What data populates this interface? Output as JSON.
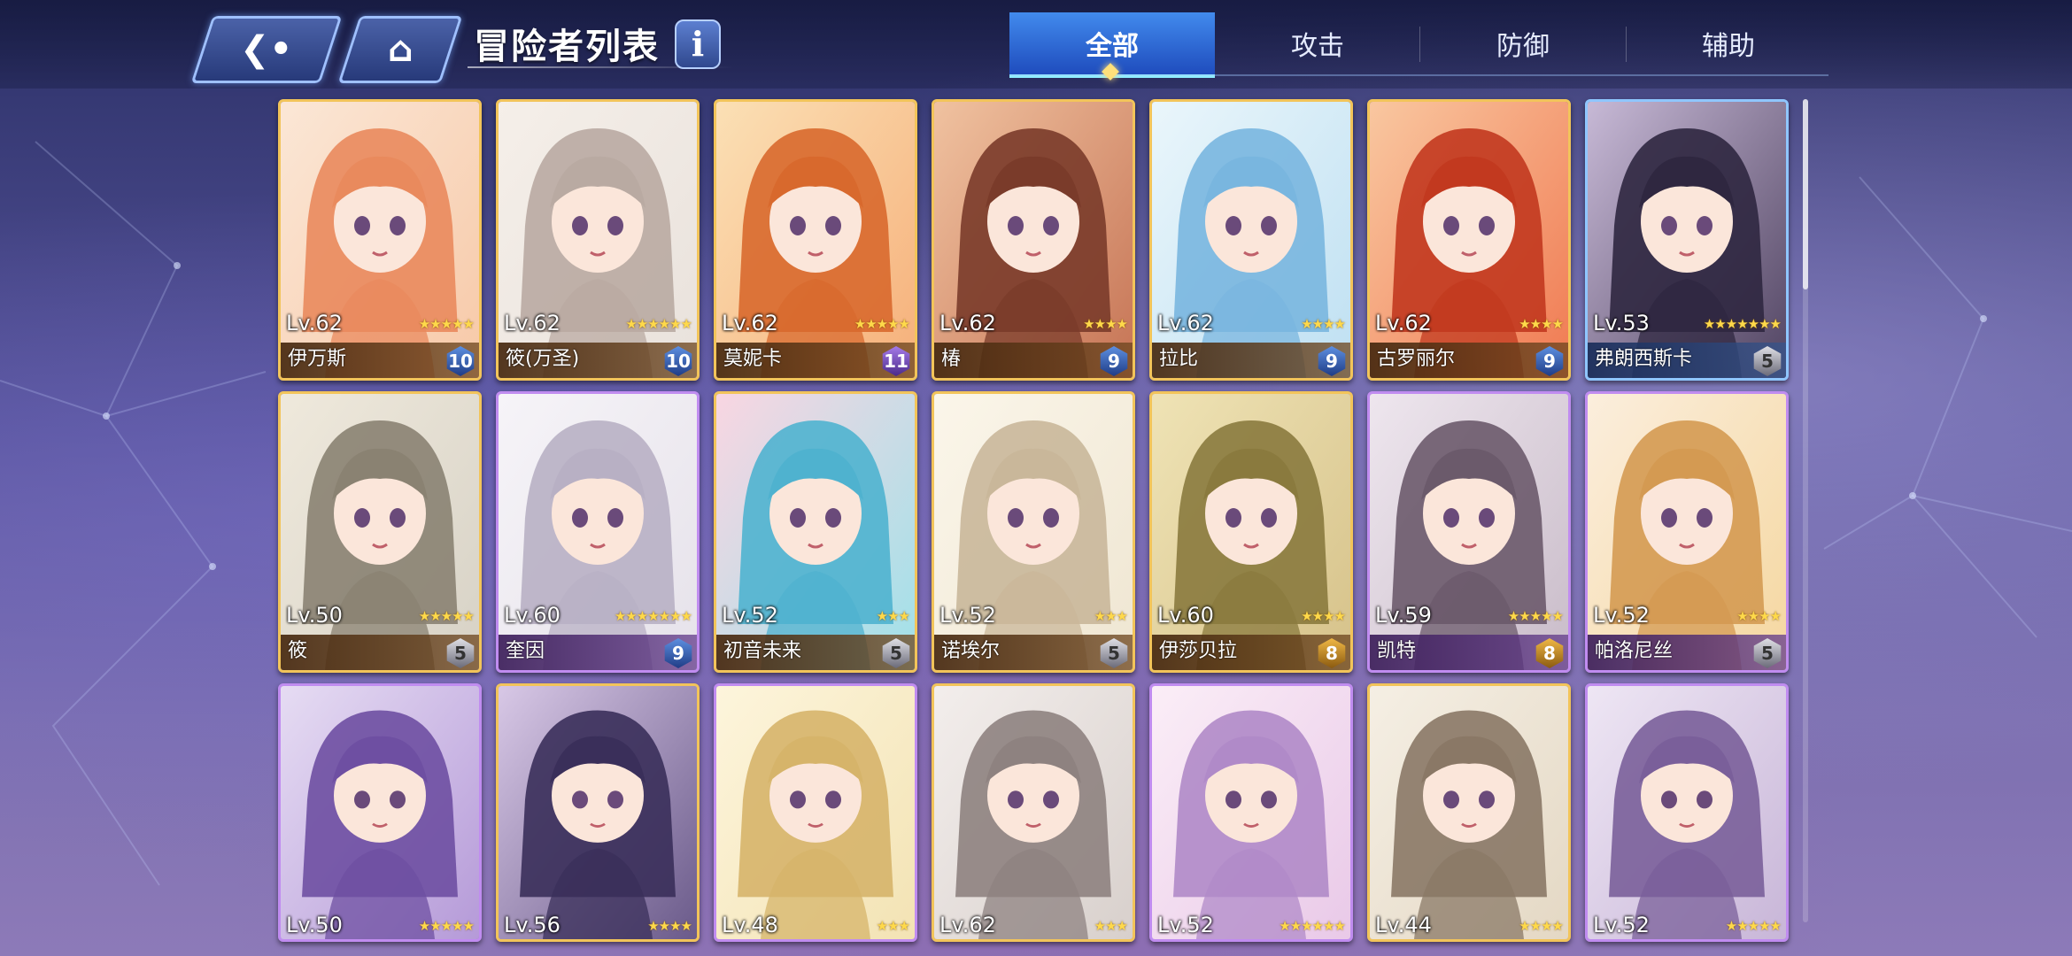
{
  "header": {
    "title": "冒险者列表",
    "back_icon": "back-arrow-icon",
    "home_icon": "home-icon",
    "info_label": "i"
  },
  "tabs": [
    {
      "label": "全部",
      "active": true
    },
    {
      "label": "攻击",
      "active": false
    },
    {
      "label": "防御",
      "active": false
    },
    {
      "label": "辅助",
      "active": false
    }
  ],
  "colors": {
    "gold_frame": "#f2c45a",
    "purple_frame": "#c08cf0",
    "blue_frame": "#8fc6ff",
    "star": "#ffd94a",
    "active_tab": "#3f8cf5"
  },
  "adventurers": [
    {
      "level": "Lv.62",
      "name": "伊万斯",
      "badge": "10",
      "stars": 5,
      "frame": "gold"
    },
    {
      "level": "Lv.62",
      "name": "筱(万圣)",
      "badge": "10",
      "stars": 6,
      "frame": "gold"
    },
    {
      "level": "Lv.62",
      "name": "莫妮卡",
      "badge": "11",
      "stars": 5,
      "frame": "gold"
    },
    {
      "level": "Lv.62",
      "name": "椿",
      "badge": "9",
      "stars": 4,
      "frame": "gold"
    },
    {
      "level": "Lv.62",
      "name": "拉比",
      "badge": "9",
      "stars": 4,
      "frame": "gold"
    },
    {
      "level": "Lv.62",
      "name": "古罗丽尔",
      "badge": "9",
      "stars": 4,
      "frame": "gold"
    },
    {
      "level": "Lv.53",
      "name": "弗朗西斯卡",
      "badge": "5",
      "stars": 7,
      "frame": "blue"
    },
    {
      "level": "Lv.50",
      "name": "筱",
      "badge": "5",
      "stars": 5,
      "frame": "gold"
    },
    {
      "level": "Lv.60",
      "name": "奎因",
      "badge": "9",
      "stars": 7,
      "frame": "purple"
    },
    {
      "level": "Lv.52",
      "name": "初音未来",
      "badge": "5",
      "stars": 3,
      "frame": "gold"
    },
    {
      "level": "Lv.52",
      "name": "诺埃尔",
      "badge": "5",
      "stars": 3,
      "frame": "gold"
    },
    {
      "level": "Lv.60",
      "name": "伊莎贝拉",
      "badge": "8",
      "stars": 4,
      "frame": "gold"
    },
    {
      "level": "Lv.59",
      "name": "凯特",
      "badge": "8",
      "stars": 5,
      "frame": "purple"
    },
    {
      "level": "Lv.52",
      "name": "帕洛尼丝",
      "badge": "5",
      "stars": 4,
      "frame": "purple"
    },
    {
      "level": "Lv.50",
      "name": "",
      "badge": "",
      "stars": 5,
      "frame": "purple"
    },
    {
      "level": "Lv.56",
      "name": "",
      "badge": "",
      "stars": 4,
      "frame": "gold"
    },
    {
      "level": "Lv.48",
      "name": "",
      "badge": "",
      "stars": 3,
      "frame": "purple"
    },
    {
      "level": "Lv.62",
      "name": "",
      "badge": "",
      "stars": 3,
      "frame": "gold"
    },
    {
      "level": "Lv.52",
      "name": "",
      "badge": "",
      "stars": 6,
      "frame": "purple"
    },
    {
      "level": "Lv.44",
      "name": "",
      "badge": "",
      "stars": 4,
      "frame": "gold"
    },
    {
      "level": "Lv.52",
      "name": "",
      "badge": "",
      "stars": 5,
      "frame": "purple"
    }
  ]
}
